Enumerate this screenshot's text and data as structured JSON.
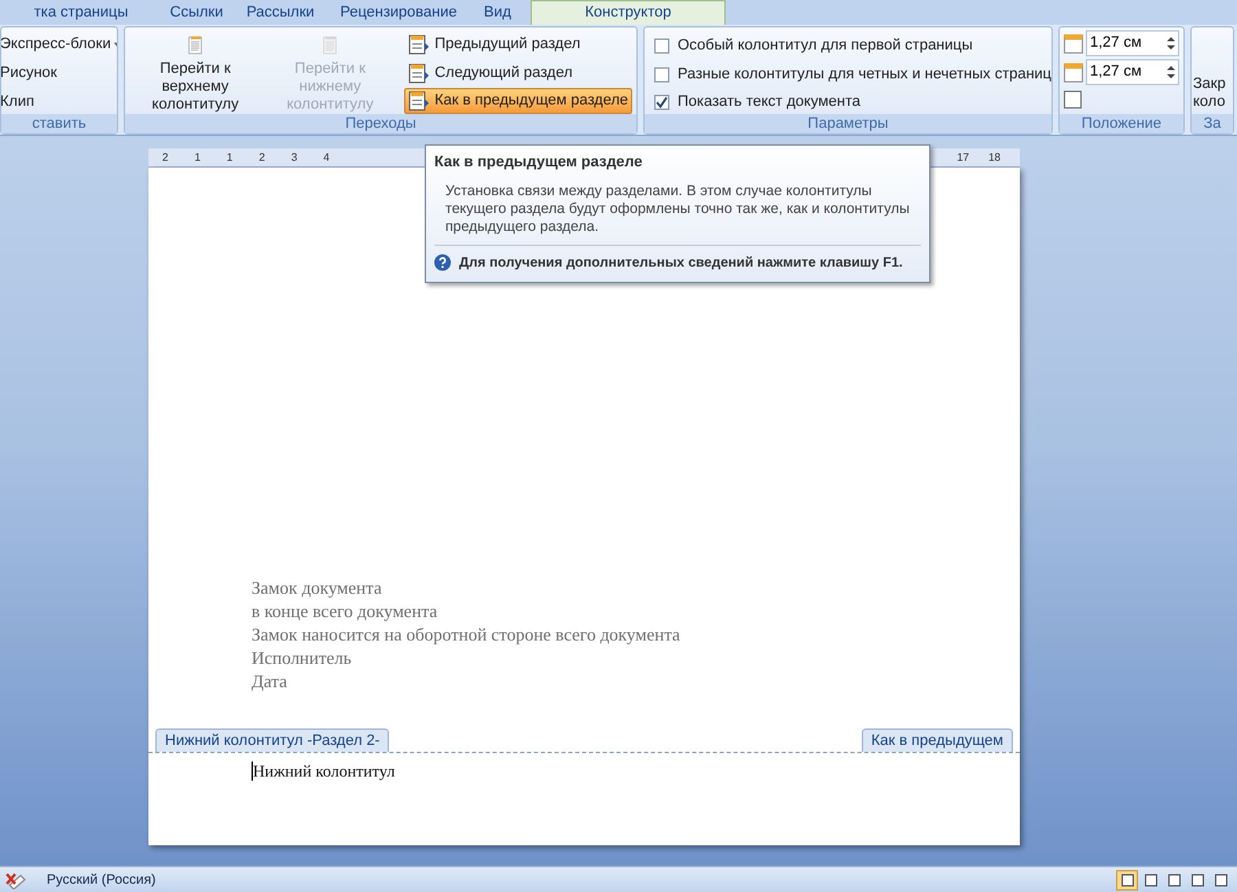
{
  "tabs": [
    {
      "label": "тка страницы",
      "selected": false
    },
    {
      "label": "Ссылки",
      "selected": false
    },
    {
      "label": "Рассылки",
      "selected": false
    },
    {
      "label": "Рецензирование",
      "selected": false
    },
    {
      "label": "Вид",
      "selected": false
    },
    {
      "label": "Конструктор",
      "selected": true
    }
  ],
  "ribbon": {
    "insert_group": {
      "items": [
        {
          "label": "Экспресс-блоки",
          "dropdown": true
        },
        {
          "label": "Рисунок",
          "dropdown": false
        },
        {
          "label": "Клип",
          "dropdown": false
        }
      ],
      "label": "ставить"
    },
    "navigation_group": {
      "large_buttons": [
        {
          "label": "Перейти к верхнему колонтитулу",
          "disabled": false
        },
        {
          "label": "Перейти к нижнему колонтитулу",
          "disabled": true
        }
      ],
      "small_buttons": [
        {
          "label": "Предыдущий раздел",
          "selected": false
        },
        {
          "label": "Следующий раздел",
          "selected": false
        },
        {
          "label": "Как в предыдущем разделе",
          "selected": true
        }
      ],
      "label": "Переходы"
    },
    "options_group": {
      "checkboxes": [
        {
          "label": "Особый колонтитул для первой страницы",
          "checked": false
        },
        {
          "label": "Разные колонтитулы для четных и нечетных страниц",
          "checked": false
        },
        {
          "label": "Показать текст документа",
          "checked": true
        }
      ],
      "label": "Параметры"
    },
    "position_group": {
      "spinners": [
        {
          "value": "1,27 см"
        },
        {
          "value": "1,27 см"
        }
      ],
      "label": "Положение"
    },
    "close_group": {
      "button_lines": [
        "Закр",
        "коло"
      ],
      "label": "За"
    }
  },
  "ruler": {
    "left_labels": [
      "2",
      "1",
      "1",
      "2",
      "3",
      "4"
    ],
    "right_labels": [
      "17",
      "18"
    ]
  },
  "tooltip": {
    "title": "Как в предыдущем разделе",
    "body": "Установка связи между разделами. В этом случае колонтитулы текущего раздела будут оформлены точно так же, как и колонтитулы предыдущего раздела.",
    "help": "Для получения дополнительных сведений нажмите клавишу F1."
  },
  "document": {
    "lines": [
      "Замок документа",
      "в конце всего документа",
      "Замок наносится на оборотной стороне всего документа",
      "Исполнитель",
      "Дата"
    ],
    "footer_tab": "Нижний колонтитул -Раздел 2-",
    "same_as_previous_tab": "Как в предыдущем",
    "footer_text": "Нижний колонтитул"
  },
  "status_bar": {
    "language": "Русский (Россия)",
    "views": [
      {
        "selected": true
      },
      {
        "selected": false
      },
      {
        "selected": false
      },
      {
        "selected": false
      },
      {
        "selected": false
      }
    ]
  }
}
